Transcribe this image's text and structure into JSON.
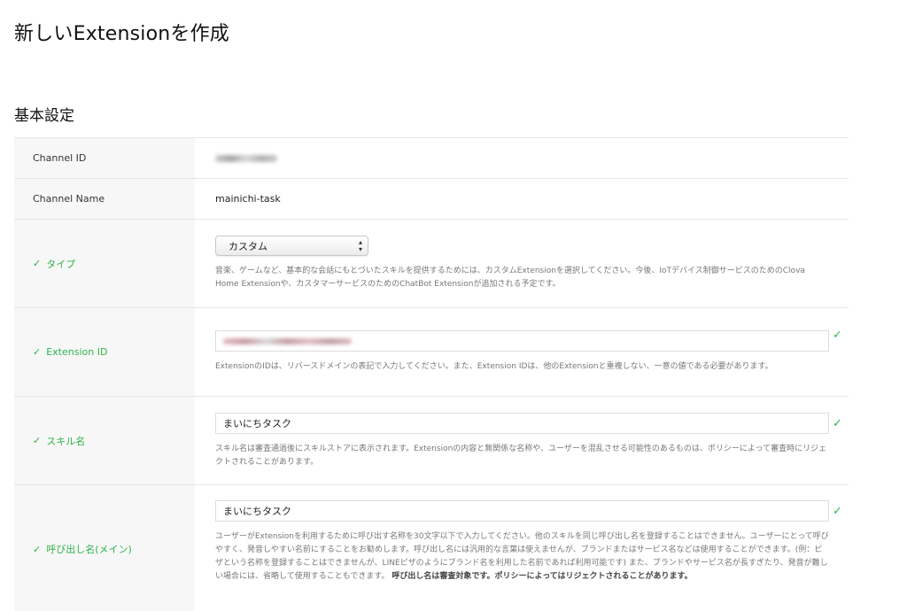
{
  "page": {
    "title": "新しいExtensionを作成",
    "section_title": "基本設定"
  },
  "form": {
    "channel_id": {
      "label": "Channel ID"
    },
    "channel_name": {
      "label": "Channel Name",
      "value": "mainichi-task"
    },
    "type": {
      "label": "タイプ",
      "selected": "カスタム",
      "help": "音楽、ゲームなど、基本的な会話にもとづいたスキルを提供するためには、カスタムExtensionを選択してください。今後、IoTデバイス制御サービスのためのClova Home Extensionや、カスタマーサービスのためのChatBot Extensionが追加される予定です。"
    },
    "extension_id": {
      "label": "Extension ID",
      "help": "ExtensionのIDは、リバースドメインの表記で入力してください。また、Extension IDは、他のExtensionと重複しない、一意の値である必要があります。"
    },
    "skill_name": {
      "label": "スキル名",
      "value": "まいにちタスク",
      "help": "スキル名は審査通過後にスキルストアに表示されます。Extensionの内容と無関係な名称や、ユーザーを混乱させる可能性のあるものは、ポリシーによって審査時にリジェクトされることがあります。"
    },
    "invocation_name": {
      "label": "呼び出し名(メイン)",
      "value": "まいにちタスク",
      "help": "ユーザーがExtensionを利用するために呼び出す名称を30文字以下で入力してください。他のスキルを同じ呼び出し名を登録することはできません。ユーザーにとって呼びやすく、発音しやすい名前にすることをお勧めします。呼び出し名には汎用的な言葉は使えませんが、ブランドまたはサービス名などは使用することができます。(例：ピザという名称を登録することはできませんが、LINEピザのようにブランド名を利用した名前であれば利用可能です) また、ブランドやサービス名が長すぎたり、発音が難しい場合には、省略して使用することもできます。",
      "help_bold": "呼び出し名は審査対象です。ポリシーによってはリジェクトされることがあります。"
    }
  },
  "icons": {
    "valid": "check-icon",
    "select": "select-arrows-icon"
  },
  "colors": {
    "valid": "#2eb34a",
    "label_bg": "#f7f7f7",
    "border": "#e6e6e6"
  }
}
